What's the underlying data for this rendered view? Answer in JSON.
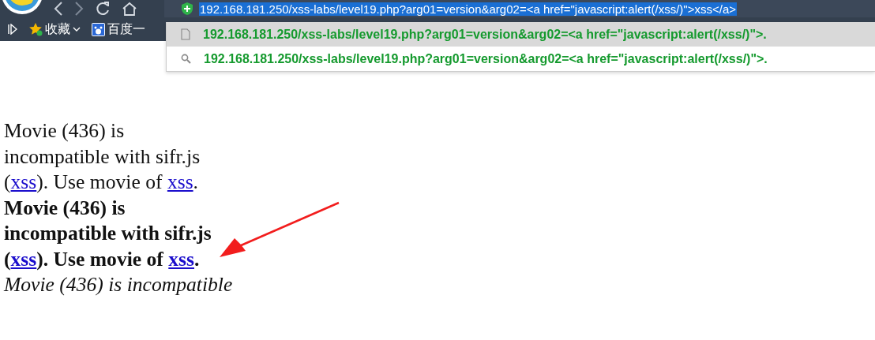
{
  "address_bar": {
    "url": "192.168.181.250/xss-labs/level19.php?arg01=version&arg02=<a href=\"javascript:alert(/xss/)\">xss</a>",
    "selected": true
  },
  "bookmarks": [
    {
      "kind": "expander"
    },
    {
      "kind": "favorites",
      "label": "收藏"
    },
    {
      "kind": "baidu",
      "label": "百度一"
    }
  ],
  "suggestions": [
    {
      "kind": "page",
      "text": "192.168.181.250/xss-labs/level19.php?arg01=version&arg02=<a href=\"javascript:alert(/xss/)\">.",
      "selected": true
    },
    {
      "kind": "search",
      "text": "192.168.181.250/xss-labs/level19.php?arg01=version&arg02=<a href=\"javascript:alert(/xss/)\">.",
      "selected": false
    }
  ],
  "paragraphs": [
    {
      "kind": "regular",
      "parts": [
        {
          "text": "Movie (436) is incompatible with sifr.js ("
        },
        {
          "link": "xss"
        },
        {
          "text": "). Use movie of "
        },
        {
          "link": "xss"
        },
        {
          "text": "."
        }
      ]
    },
    {
      "kind": "bold",
      "parts": [
        {
          "text": "Movie (436) is incompatible with sifr.js ("
        },
        {
          "link": "xss"
        },
        {
          "text": "). Use movie of "
        },
        {
          "link": "xss"
        },
        {
          "text": "."
        }
      ]
    },
    {
      "kind": "italic",
      "parts": [
        {
          "text": "Movie (436) is incompatible"
        }
      ]
    }
  ]
}
